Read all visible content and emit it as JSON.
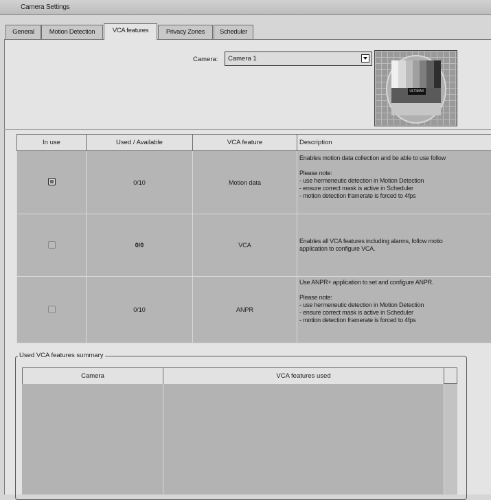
{
  "window": {
    "title": "Camera Settings"
  },
  "tabs": [
    "General",
    "Motion Detection",
    "VCA features",
    "Privacy Zones",
    "Scheduler"
  ],
  "active_tab": "VCA features",
  "camera": {
    "label": "Camera:",
    "selected": "Camera 1"
  },
  "preview_text": "ULTIMAX",
  "features_table": {
    "headers": [
      "In use",
      "Used  / Available",
      "VCA feature",
      "Description"
    ],
    "rows": [
      {
        "in_use": true,
        "used_available": "0/10",
        "feature": "Motion data",
        "description": [
          "Enables motion data collection and be able to use follow",
          "",
          "Please note:",
          "- use hermeneutic detection in Motion Detection",
          "- ensure correct mask is active in Scheduler",
          "- motion detection framerate is forced to 4fps"
        ]
      },
      {
        "in_use": false,
        "used_available": "0/0",
        "feature": "VCA",
        "description": [
          "Enables all VCA features including alarms, follow motio",
          "application to configure VCA."
        ]
      },
      {
        "in_use": false,
        "used_available": "0/10",
        "feature": "ANPR",
        "description": [
          "Use ANPR+ application to set and configure ANPR.",
          "",
          "Please note:",
          "- use hermeneutic detection in Motion Detection",
          "- ensure correct mask is active in Scheduler",
          "- motion detection framerate is forced to 4fps"
        ]
      }
    ]
  },
  "summary": {
    "label": "Used VCA features summary",
    "headers": [
      "Camera",
      "VCA features used"
    ]
  }
}
